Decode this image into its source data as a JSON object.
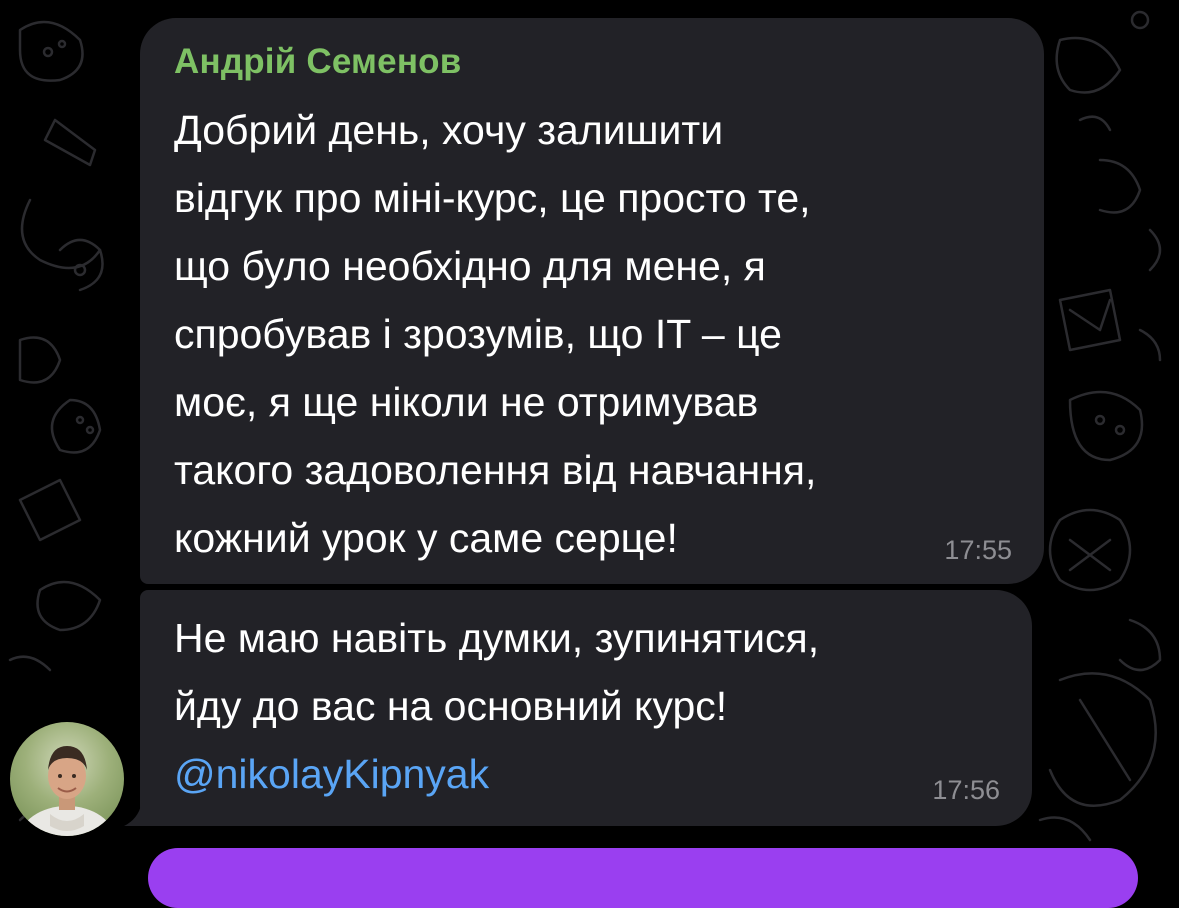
{
  "colors": {
    "background": "#000000",
    "bubble": "#222227",
    "sender_name": "#7ec164",
    "text": "#ffffff",
    "timestamp": "#8e8e93",
    "mention": "#5aa5f5",
    "accent_bar": "#9a3ff0"
  },
  "messages": [
    {
      "sender": "Андрій Семенов",
      "lines": [
        "Добрий день, хочу залишити",
        "відгук про міні-курс, це просто те,",
        "що було необхідно для мене, я",
        "спробував і зрозумів, що IT – це",
        "моє, я ще ніколи не отримував",
        "такого задоволення від навчання,",
        "кожний урок у саме серце!"
      ],
      "time": "17:55"
    },
    {
      "lines": [
        "Не маю навіть думки, зупинятися,",
        "йду до вас на основний курс!"
      ],
      "mention": "@nikolayKipnyak",
      "time": "17:56"
    }
  ]
}
